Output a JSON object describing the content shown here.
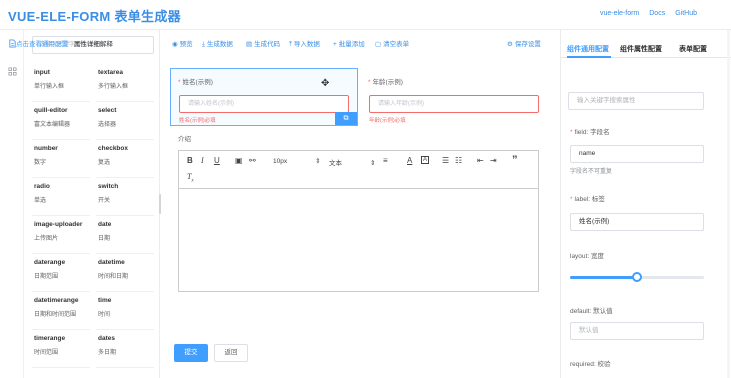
{
  "header": {
    "logo": "VUE-ELE-FORM 表单生成器",
    "links": [
      "vue-ele-form",
      "Docs",
      "GitHub"
    ]
  },
  "palette": {
    "search_placeholder": "请输入关键字查找组件",
    "items": [
      {
        "name": "input",
        "desc": "单行输入框"
      },
      {
        "name": "textarea",
        "desc": "多行输入框"
      },
      {
        "name": "quill-editor",
        "desc": "富文本编辑器"
      },
      {
        "name": "select",
        "desc": "选择器"
      },
      {
        "name": "number",
        "desc": "数字"
      },
      {
        "name": "checkbox",
        "desc": "复选"
      },
      {
        "name": "radio",
        "desc": "单选"
      },
      {
        "name": "switch",
        "desc": "开关"
      },
      {
        "name": "image-uploader",
        "desc": "上传图片"
      },
      {
        "name": "date",
        "desc": "日期"
      },
      {
        "name": "daterange",
        "desc": "日期范围"
      },
      {
        "name": "datetime",
        "desc": "时间和日期"
      },
      {
        "name": "datetimerange",
        "desc": "日期和时间范围"
      },
      {
        "name": "time",
        "desc": "时间"
      },
      {
        "name": "timerange",
        "desc": "时间范围"
      },
      {
        "name": "dates",
        "desc": "多日期"
      }
    ]
  },
  "toolbar": {
    "preview": "预览",
    "gen_data": "生成数据",
    "gen_code": "生成代码",
    "import_data": "导入数据",
    "batch_add": "批量添加",
    "clear": "清空表单",
    "save": "保存设置"
  },
  "form": {
    "name_label": "姓名(示例)",
    "name_placeholder": "请输入姓名(示例)",
    "name_error": "姓名(示例)必填",
    "age_label": "年龄(示例)",
    "age_placeholder": "请输入年龄(示例)",
    "age_error": "年龄(示例)必填",
    "intro_label": "介绍",
    "submit": "提交",
    "back": "返回"
  },
  "editor": {
    "size_value": "10px",
    "font_value": "文本"
  },
  "rpanel": {
    "tabs": [
      "组件通用配置",
      "组件属性配置",
      "表单配置"
    ],
    "link_common": "点击查看通用配置",
    "link_attrs": "属性详细解释",
    "search_placeholder": "输入关键字搜索属性",
    "field_label": "field: 字段名",
    "field_value": "name",
    "field_hint": "字段名不可重复",
    "label_label": "label: 标签",
    "label_value": "姓名(示例)",
    "layout_label": "layout: 宽度",
    "layout_fraction": 0.5,
    "default_label": "default: 默认值",
    "default_placeholder": "默认值",
    "required_label": "required: 校验"
  },
  "colors": {
    "accent": "#409eff",
    "error": "#f56c6c",
    "logo": "#3a8ee6"
  }
}
